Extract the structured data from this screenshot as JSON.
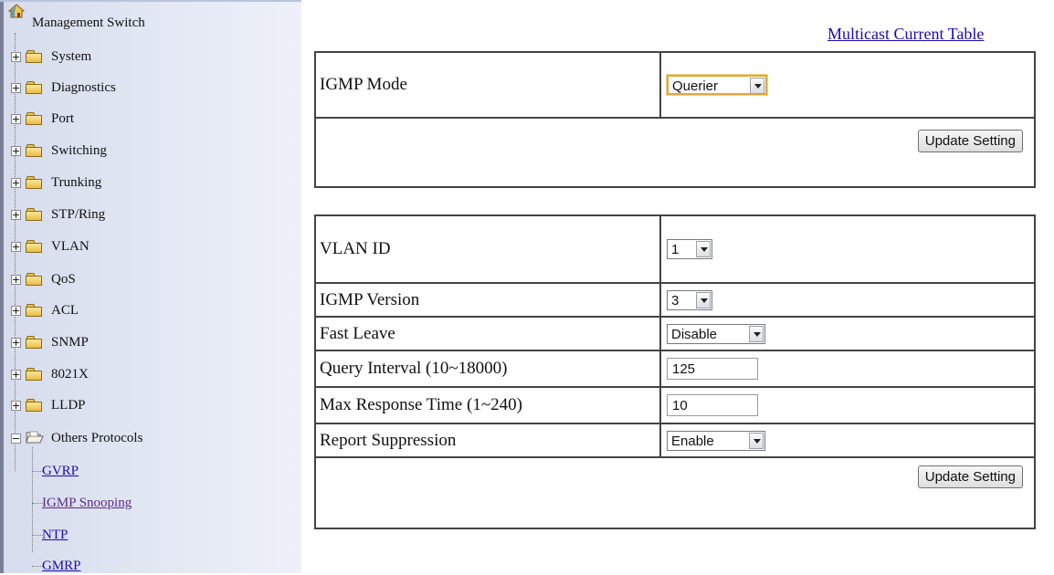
{
  "sidebar": {
    "root_label": "Management Switch",
    "items": [
      {
        "label": "System"
      },
      {
        "label": "Diagnostics"
      },
      {
        "label": "Port"
      },
      {
        "label": "Switching"
      },
      {
        "label": "Trunking"
      },
      {
        "label": "STP/Ring"
      },
      {
        "label": "VLAN"
      },
      {
        "label": "QoS"
      },
      {
        "label": "ACL"
      },
      {
        "label": "SNMP"
      },
      {
        "label": "8021X"
      },
      {
        "label": "LLDP"
      },
      {
        "label": "Others Protocols"
      }
    ],
    "children": [
      {
        "label": "GVRP"
      },
      {
        "label": "IGMP Snooping"
      },
      {
        "label": "NTP"
      },
      {
        "label": "GMRP"
      }
    ]
  },
  "main": {
    "multicast_link": "Multicast Current Table",
    "mode_section": {
      "mode_label": "IGMP Mode",
      "mode_value": "Querier",
      "update_button": "Update Setting"
    },
    "vlan_section": {
      "vlan_id_label": "VLAN ID",
      "vlan_id_value": "1",
      "igmp_version_label": "IGMP Version",
      "igmp_version_value": "3",
      "fast_leave_label": "Fast Leave",
      "fast_leave_value": "Disable",
      "query_interval_label": "Query Interval (10~18000)",
      "query_interval_value": "125",
      "max_response_label": "Max Response Time (1~240)",
      "max_response_value": "10",
      "report_suppression_label": "Report Suppression",
      "report_suppression_value": "Enable",
      "update_button": "Update Setting"
    }
  }
}
